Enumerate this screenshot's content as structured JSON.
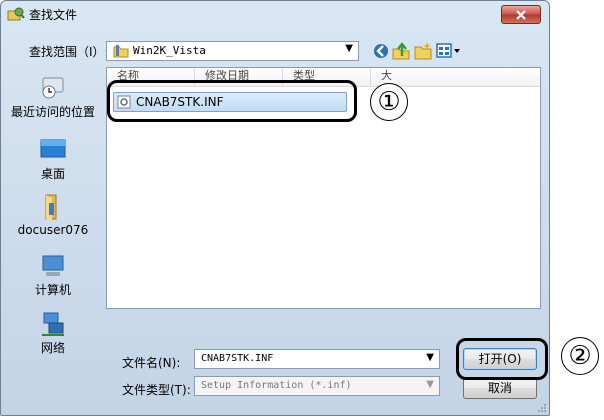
{
  "window": {
    "title": "查找文件",
    "close_icon": "close-icon"
  },
  "lookin": {
    "label": "查找范围（I）:",
    "value": "Win2K_Vista"
  },
  "toolbar": [
    "back-icon",
    "up-folder-icon",
    "new-folder-icon",
    "view-menu-icon"
  ],
  "places": [
    {
      "label": "最近访问的位置",
      "icon": "recent-places-icon"
    },
    {
      "label": "桌面",
      "icon": "desktop-icon"
    },
    {
      "label": "docuser076",
      "icon": "user-folder-icon"
    },
    {
      "label": "计算机",
      "icon": "computer-icon"
    },
    {
      "label": "网络",
      "icon": "network-icon"
    }
  ],
  "filelist": {
    "columns": [
      "名称",
      "修改日期",
      "类型",
      "大"
    ],
    "files": [
      {
        "name": "CNAB7STK.INF",
        "icon": "setup-file-icon",
        "selected": true
      }
    ]
  },
  "filename": {
    "label": "文件名(N):",
    "value": "CNAB7STK.INF"
  },
  "filetype": {
    "label": "文件类型(T):",
    "value": "Setup Information (*.inf)"
  },
  "buttons": {
    "open": "打开(O)",
    "cancel": "取消"
  },
  "callouts": [
    "①",
    "②"
  ],
  "colors": {
    "dialog_bg": "#c9d9eb",
    "selection": "#cde3f7",
    "close_button": "#c75050"
  }
}
